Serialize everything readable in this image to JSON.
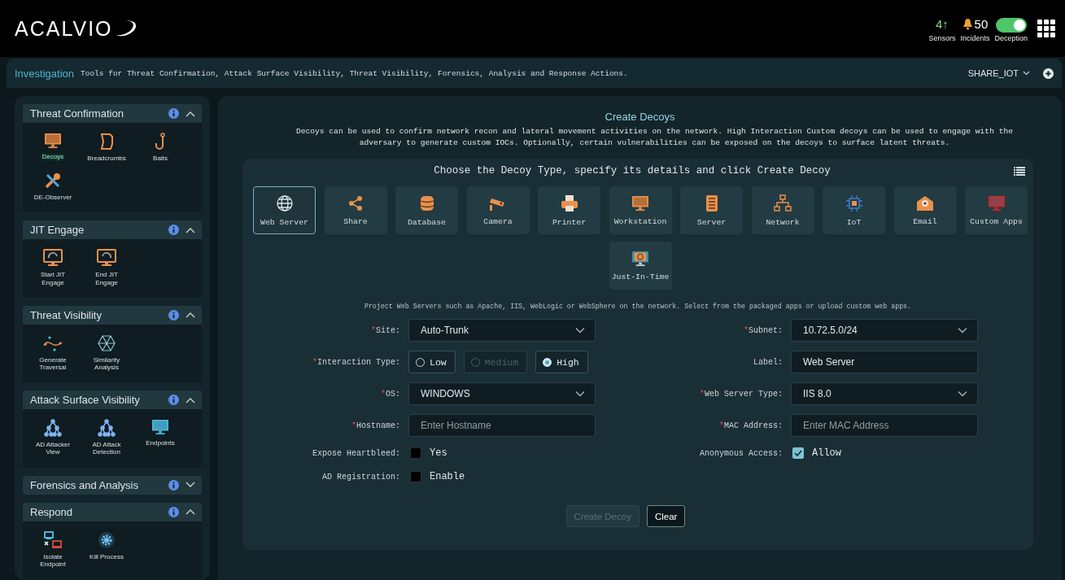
{
  "header": {
    "logo": "ACALVIO",
    "sensors": {
      "count": "4↑",
      "label": "Sensors"
    },
    "incidents": {
      "count": "50",
      "label": "Incidents"
    },
    "deception": {
      "label": "Deception",
      "on": true
    }
  },
  "page_bar": {
    "title": "Investigation",
    "description": "Tools for Threat Confirmation, Attack Surface Visibility, Threat Visibility, Forensics, Analysis and Response Actions.",
    "workspace": "SHARE_IOT"
  },
  "sidebar": {
    "sections": [
      {
        "title": "Threat Confirmation",
        "expanded": true,
        "items": [
          {
            "label": "Decoys",
            "selected": true
          },
          {
            "label": "Breadcrumbs",
            "selected": false
          },
          {
            "label": "Baits",
            "selected": false
          },
          {
            "label": "DE-Observer",
            "selected": false
          }
        ]
      },
      {
        "title": "JIT Engage",
        "expanded": true,
        "items": [
          {
            "label": "Start JIT\nEngage",
            "selected": false
          },
          {
            "label": "End JIT\nEngage",
            "selected": false
          }
        ]
      },
      {
        "title": "Threat Visibility",
        "expanded": true,
        "items": [
          {
            "label": "Generate\nTraversal",
            "selected": false
          },
          {
            "label": "Similarity\nAnalysis",
            "selected": false
          }
        ]
      },
      {
        "title": "Attack Surface Visibility",
        "expanded": true,
        "items": [
          {
            "label": "AD Attacker\nView",
            "selected": false
          },
          {
            "label": "AD Attack\nDetection",
            "selected": false
          },
          {
            "label": "Endpoints",
            "selected": false
          }
        ]
      },
      {
        "title": "Forensics and Analysis",
        "expanded": false
      },
      {
        "title": "Respond",
        "expanded": true,
        "items": [
          {
            "label": "Isolate\nEndpoint",
            "selected": false
          },
          {
            "label": "Kill Process",
            "selected": false
          }
        ]
      }
    ]
  },
  "main": {
    "title": "Create Decoys",
    "description": "Decoys can be used to confirm network recon and lateral movement activities on the network. High Interaction Custom decoys can be used to engage with the adversary to generate custom IOCs. Optionally, certain vulnerabilities can be exposed on the decoys to surface latent threats.",
    "chooser": {
      "heading": "Choose the Decoy Type, specify its details and click Create Decoy",
      "decoy_types": [
        {
          "label": "Web Server",
          "selected": true
        },
        {
          "label": "Share",
          "selected": false
        },
        {
          "label": "Database",
          "selected": false
        },
        {
          "label": "Camera",
          "selected": false
        },
        {
          "label": "Printer",
          "selected": false
        },
        {
          "label": "Workstation",
          "selected": false
        },
        {
          "label": "Server",
          "selected": false
        },
        {
          "label": "Network",
          "selected": false
        },
        {
          "label": "IoT",
          "selected": false
        },
        {
          "label": "Email",
          "selected": false
        },
        {
          "label": "Custom Apps",
          "selected": false
        },
        {
          "label": "Just-In-Time",
          "selected": false
        }
      ],
      "hint": "Project Web Servers such as Apache, IIS, WebLogic or WebSphere on the network. Select from the packaged apps or upload custom web apps.",
      "left_fields": [
        {
          "kind": "select",
          "mark": "*",
          "label": "Site:",
          "value": "Auto-Trunk"
        },
        {
          "kind": "radio",
          "mark": "*",
          "label": "Interaction Type:",
          "options": [
            {
              "label": "Low",
              "selected": false,
              "disabled": false
            },
            {
              "label": "Medium",
              "selected": false,
              "disabled": true
            },
            {
              "label": "High",
              "selected": true,
              "disabled": false
            }
          ]
        },
        {
          "kind": "select",
          "mark": "*",
          "label": "OS:",
          "value": "WINDOWS"
        },
        {
          "kind": "text",
          "mark": "*",
          "label": "Hostname:",
          "placeholder": "Enter Hostname"
        },
        {
          "kind": "checkbox",
          "label": "Expose Heartbleed:",
          "option": "Yes",
          "checked": false
        },
        {
          "kind": "checkbox",
          "label": "AD Registration:",
          "option": "Enable",
          "checked": false
        }
      ],
      "right_fields": [
        {
          "kind": "select",
          "mark": "*",
          "label": "Subnet:",
          "value": "10.72.5.0/24"
        },
        {
          "kind": "text",
          "label": "Label:",
          "value": "Web Server"
        },
        {
          "kind": "select",
          "mark": "*",
          "label": "Web Server Type:",
          "value": "IIS 8.0"
        },
        {
          "kind": "text",
          "mark": "*",
          "label": "MAC Address:",
          "placeholder": "Enter MAC Address"
        },
        {
          "kind": "checkbox",
          "label": "Anonymous Access:",
          "option": "Allow",
          "checked": true
        }
      ],
      "buttons": [
        {
          "label": "Create Decoy",
          "disabled": true
        },
        {
          "label": "Clear",
          "disabled": false
        }
      ]
    }
  }
}
